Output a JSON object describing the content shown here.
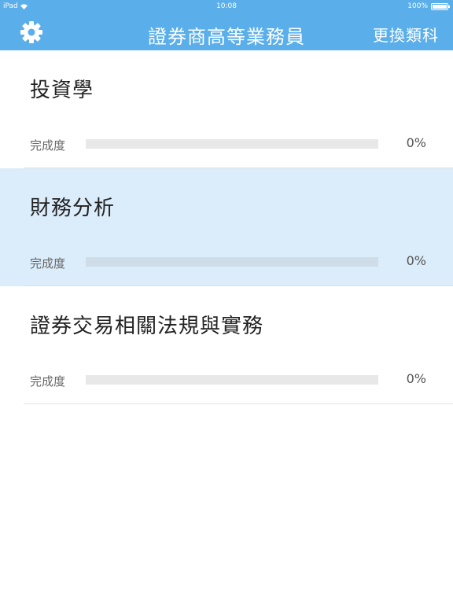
{
  "status_bar": {
    "carrier": "iPad",
    "time": "10:08",
    "battery": "100%"
  },
  "nav": {
    "title": "證券商高等業務員",
    "change_label": "更換類科",
    "settings_icon": "gear-icon",
    "accent_color": "#5aaeea"
  },
  "subjects": [
    {
      "title": "投資學",
      "progress_label": "完成度",
      "progress_text": "0%",
      "progress": 0,
      "selected": false
    },
    {
      "title": "財務分析",
      "progress_label": "完成度",
      "progress_text": "0%",
      "progress": 0,
      "selected": true
    },
    {
      "title": "證券交易相關法規與實務",
      "progress_label": "完成度",
      "progress_text": "0%",
      "progress": 0,
      "selected": false
    }
  ]
}
